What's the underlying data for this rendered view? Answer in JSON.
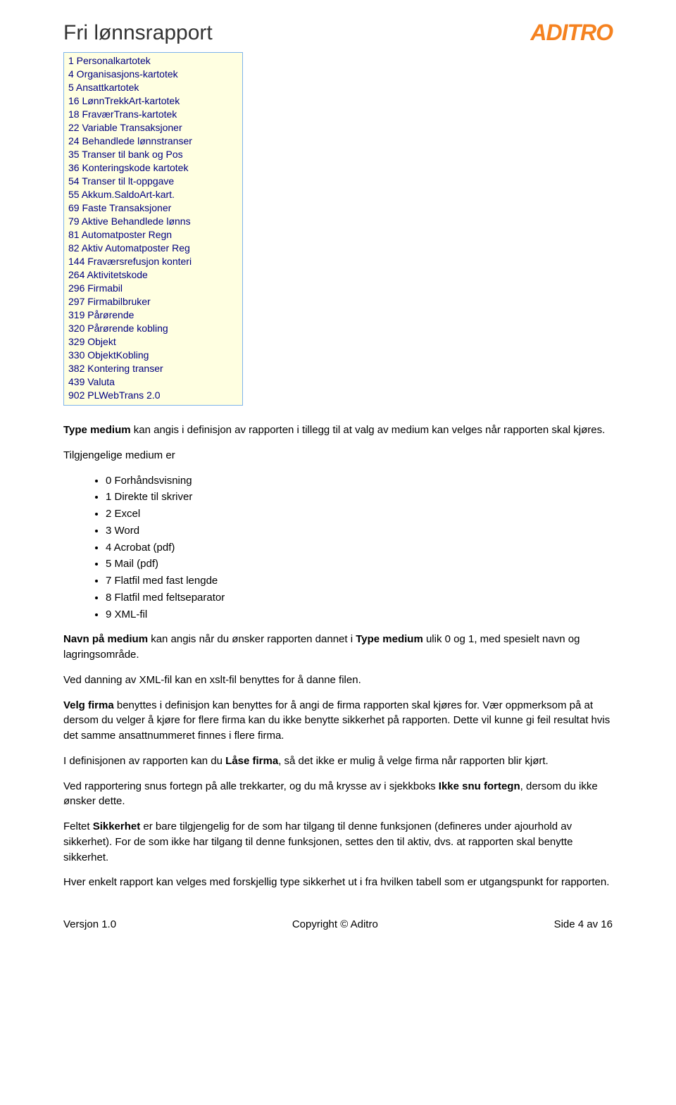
{
  "header": {
    "title": "Fri lønnsrapport",
    "logo_text": "ADITRO"
  },
  "listbox": {
    "items": [
      "1 Personalkartotek",
      "4 Organisasjons-kartotek",
      "5 Ansattkartotek",
      "16 LønnTrekkArt-kartotek",
      "18 FraværTrans-kartotek",
      "22 Variable Transaksjoner",
      "24 Behandlede lønnstranser",
      "35 Transer til bank og Pos",
      "36 Konteringskode kartotek",
      "54 Transer til lt-oppgave",
      "55 Akkum.SaldoArt-kart.",
      "69 Faste Transaksjoner",
      "79 Aktive Behandlede lønns",
      "81 Automatposter Regn",
      "82 Aktiv Automatposter Reg",
      "144 Fraværsrefusjon konteri",
      "264 Aktivitetskode",
      "296 Firmabil",
      "297 Firmabilbruker",
      "319 Pårørende",
      "320 Pårørende kobling",
      "329 Objekt",
      "330 ObjektKobling",
      "382 Kontering transer",
      "439 Valuta",
      "902 PLWebTrans 2.0"
    ]
  },
  "body": {
    "p1_a": "Type medium",
    "p1_b": " kan angis i definisjon av rapporten i tillegg til at valg av medium kan velges når rapporten skal kjøres.",
    "p2": "Tilgjengelige medium er",
    "media": [
      "0   Forhåndsvisning",
      "1   Direkte til skriver",
      "2   Excel",
      "3   Word",
      "4   Acrobat (pdf)",
      "5   Mail (pdf)",
      "7   Flatfil med fast lengde",
      "8   Flatfil med feltseparator",
      "9   XML-fil"
    ],
    "p3_a": "Navn på medium",
    "p3_b": " kan angis når du ønsker rapporten dannet i ",
    "p3_c": "Type medium",
    "p3_d": " ulik 0 og 1, med spesielt navn og lagringsområde.",
    "p4": "Ved danning av XML-fil kan en xslt-fil benyttes for å danne filen.",
    "p5_a": "Velg firma",
    "p5_b": " benyttes i definisjon kan benyttes for å angi de firma rapporten skal kjøres for. Vær oppmerksom på at dersom du velger å kjøre for flere firma kan du ikke benytte sikkerhet på rapporten. Dette vil kunne gi feil resultat hvis det samme ansattnummeret finnes i flere firma.",
    "p6_a": "I definisjonen av rapporten kan du ",
    "p6_b": "Låse firma",
    "p6_c": ", så det ikke er mulig å velge firma når rapporten blir kjørt.",
    "p7_a": "Ved rapportering snus fortegn på alle trekkarter, og du må krysse av i sjekkboks ",
    "p7_b": "Ikke snu fortegn",
    "p7_c": ", dersom du ikke ønsker dette.",
    "p8_a": "Feltet ",
    "p8_b": "Sikkerhet",
    "p8_c": " er bare tilgjengelig for de som har tilgang til denne funksjonen (defineres under ajourhold av sikkerhet). For de som ikke har tilgang til denne funksjonen, settes den til aktiv, dvs. at rapporten skal benytte sikkerhet.",
    "p9": "Hver enkelt rapport kan velges med forskjellig type sikkerhet ut i fra hvilken tabell som er utgangspunkt for rapporten."
  },
  "footer": {
    "left": "Versjon 1.0",
    "center": "Copyright © Aditro",
    "right": "Side 4 av 16"
  }
}
